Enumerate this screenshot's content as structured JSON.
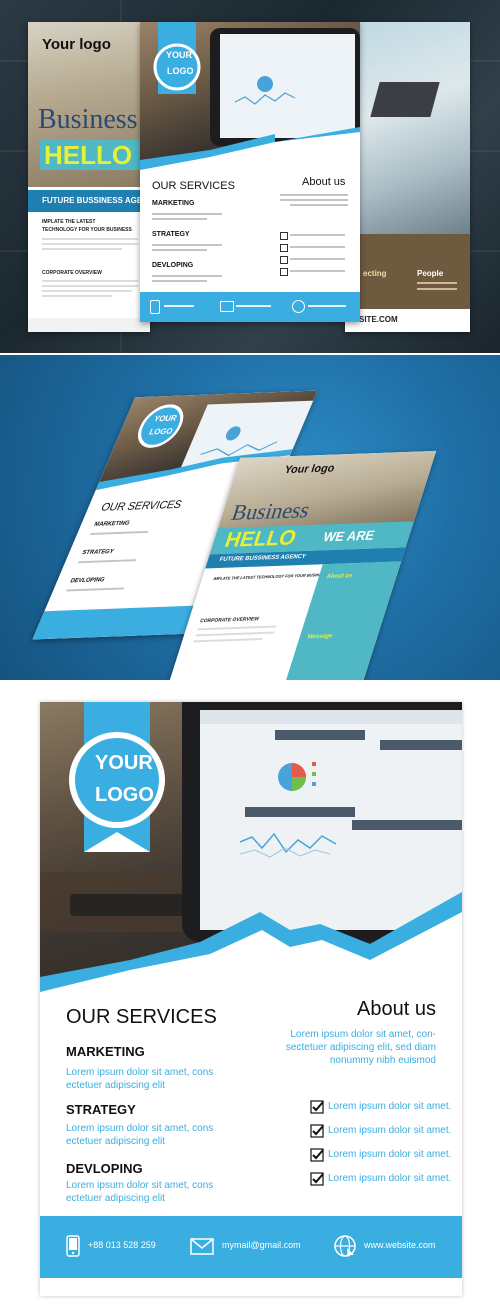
{
  "flyer_left": {
    "logo": "Your logo",
    "business": "Business",
    "hello": "HELLO",
    "agency": "FUTURE BUSSINESS AGE",
    "headline1": "IMPLATE THE LATEST",
    "headline2": "TECHNOLOGY FOR YOUR BUSINESS",
    "overview": "CORPORATE OVERVIEW"
  },
  "flyer_right": {
    "website": "SITE.COM",
    "people": "People",
    "ecting": "ecting"
  },
  "main": {
    "logo_line1": "YOUR",
    "logo_line2": "LOGO",
    "services_title": "OUR SERVICES",
    "marketing": "MARKETING",
    "strategy": "STRATEGY",
    "devloping": "DEVLOPING",
    "about_title": "About us",
    "body1": "Lorem ipsum dolor sit amet, cons",
    "body2": "ectetuer adipiscing elit",
    "about1": "Lorem ipsum dolor sit amet, con-",
    "about2": "sectetuer adipiscing elit, sed diam",
    "about3": "nonummy nibh euismod",
    "check_item": "Lorem ipsum dolor sit amet.",
    "phone": "+88 013 528 259",
    "email": "mymail@gmail.com",
    "website": "www.website.com"
  },
  "mockup": {
    "services": "OUR SERVICES",
    "marketing": "MARKETING",
    "strategy": "STRATEGY",
    "devloping": "DEVLOPING",
    "your_logo": "Your logo",
    "business": "Business",
    "hello": "HELLO",
    "we_are": "WE ARE",
    "agency": "FUTURE BUSSINESS AGENCY",
    "headline": "IMPLATE THE LATEST TECHNOLOGY FOR YOUR BUSINESS",
    "overview": "CORPORATE OVERVIEW",
    "about": "About us",
    "message": "Message",
    "logo_line1": "YOUR",
    "logo_line2": "LOGO"
  },
  "colors": {
    "accent": "#3aaee0",
    "lime": "#c8e63c",
    "teal": "#4fb8c4",
    "brown": "#6e5a3f"
  }
}
